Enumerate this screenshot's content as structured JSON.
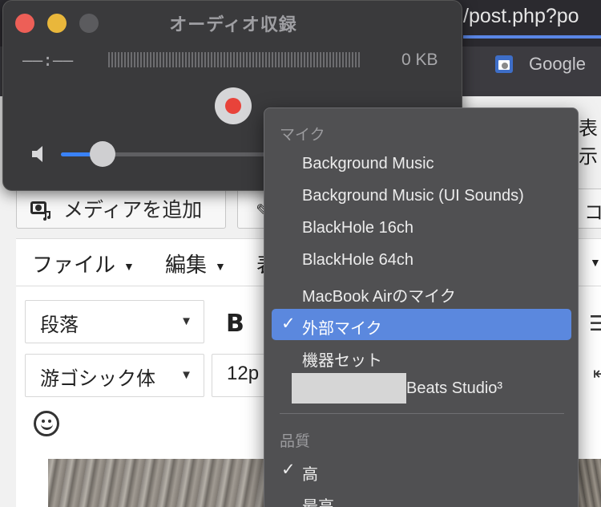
{
  "browser": {
    "url_text": "/post.php?po",
    "tab_label": "Google"
  },
  "editor": {
    "right_label": "表示",
    "add_media_label": "メディアを追加",
    "right_button_glyph": "コ",
    "menus": [
      {
        "label": "ファイル"
      },
      {
        "label": "編集"
      },
      {
        "label": "表"
      }
    ],
    "paragraph_select": "段落",
    "bold_label": "B",
    "font_select": "游ゴシック体",
    "size_select": "12p"
  },
  "recorder": {
    "title": "オーディオ収録",
    "time": "––:––",
    "size": "0 KB",
    "volume_level": 0.2
  },
  "menu": {
    "section_input": "マイク",
    "inputs": [
      {
        "label": "Background Music",
        "checked": false
      },
      {
        "label": "Background Music (UI Sounds)",
        "checked": false
      },
      {
        "label": "BlackHole 16ch",
        "checked": false
      },
      {
        "label": "BlackHole 64ch",
        "checked": false
      },
      {
        "label": "MacBook Airのマイク",
        "checked": false
      },
      {
        "label": "外部マイク",
        "checked": true
      },
      {
        "label": "機器セット",
        "checked": false
      },
      {
        "label": "Beats Studio³",
        "checked": false
      }
    ],
    "section_quality": "品質",
    "qualities": [
      {
        "label": "高",
        "checked": true
      },
      {
        "label": "最高",
        "checked": false
      }
    ],
    "check_glyph": "✓"
  },
  "colors": {
    "accent": "#5b88de",
    "record_red": "#e8433a",
    "slider_blue": "#3a82f7"
  }
}
